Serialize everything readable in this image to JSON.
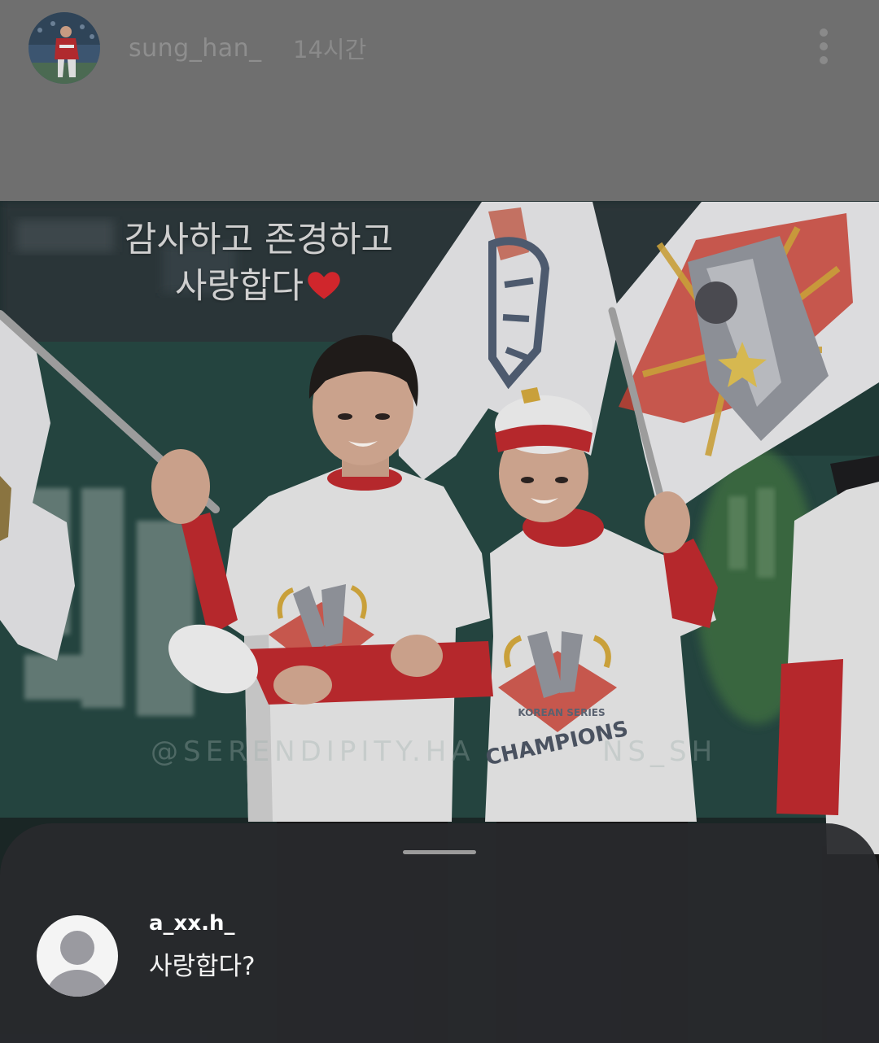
{
  "story": {
    "author": {
      "username": "sung_han_",
      "posted_ago": "14시간",
      "avatar": "profile-photo"
    },
    "menu_icon": "more-vertical-icon",
    "caption": {
      "line1": "감사하고 존경하고",
      "line2": "사랑합다",
      "line2_emoji": "red-heart-icon"
    },
    "photo": {
      "shirt_logo_top": "KOREAN SERIES",
      "shirt_logo_main": "CHAMPIONS",
      "watermark_visible": [
        "@SERENDIPITY.HA",
        "NS_SH"
      ]
    }
  },
  "reply_sheet": {
    "handle": "drag-handle",
    "replies": [
      {
        "username": "a_xx.h_",
        "text": "사랑합다?",
        "avatar": "default-avatar-icon"
      }
    ]
  },
  "colors": {
    "header_bg": "#6f6f6f",
    "sheet_bg": "#2b2c30",
    "heart": "#d0262c",
    "jersey_red": "#b5282c"
  }
}
